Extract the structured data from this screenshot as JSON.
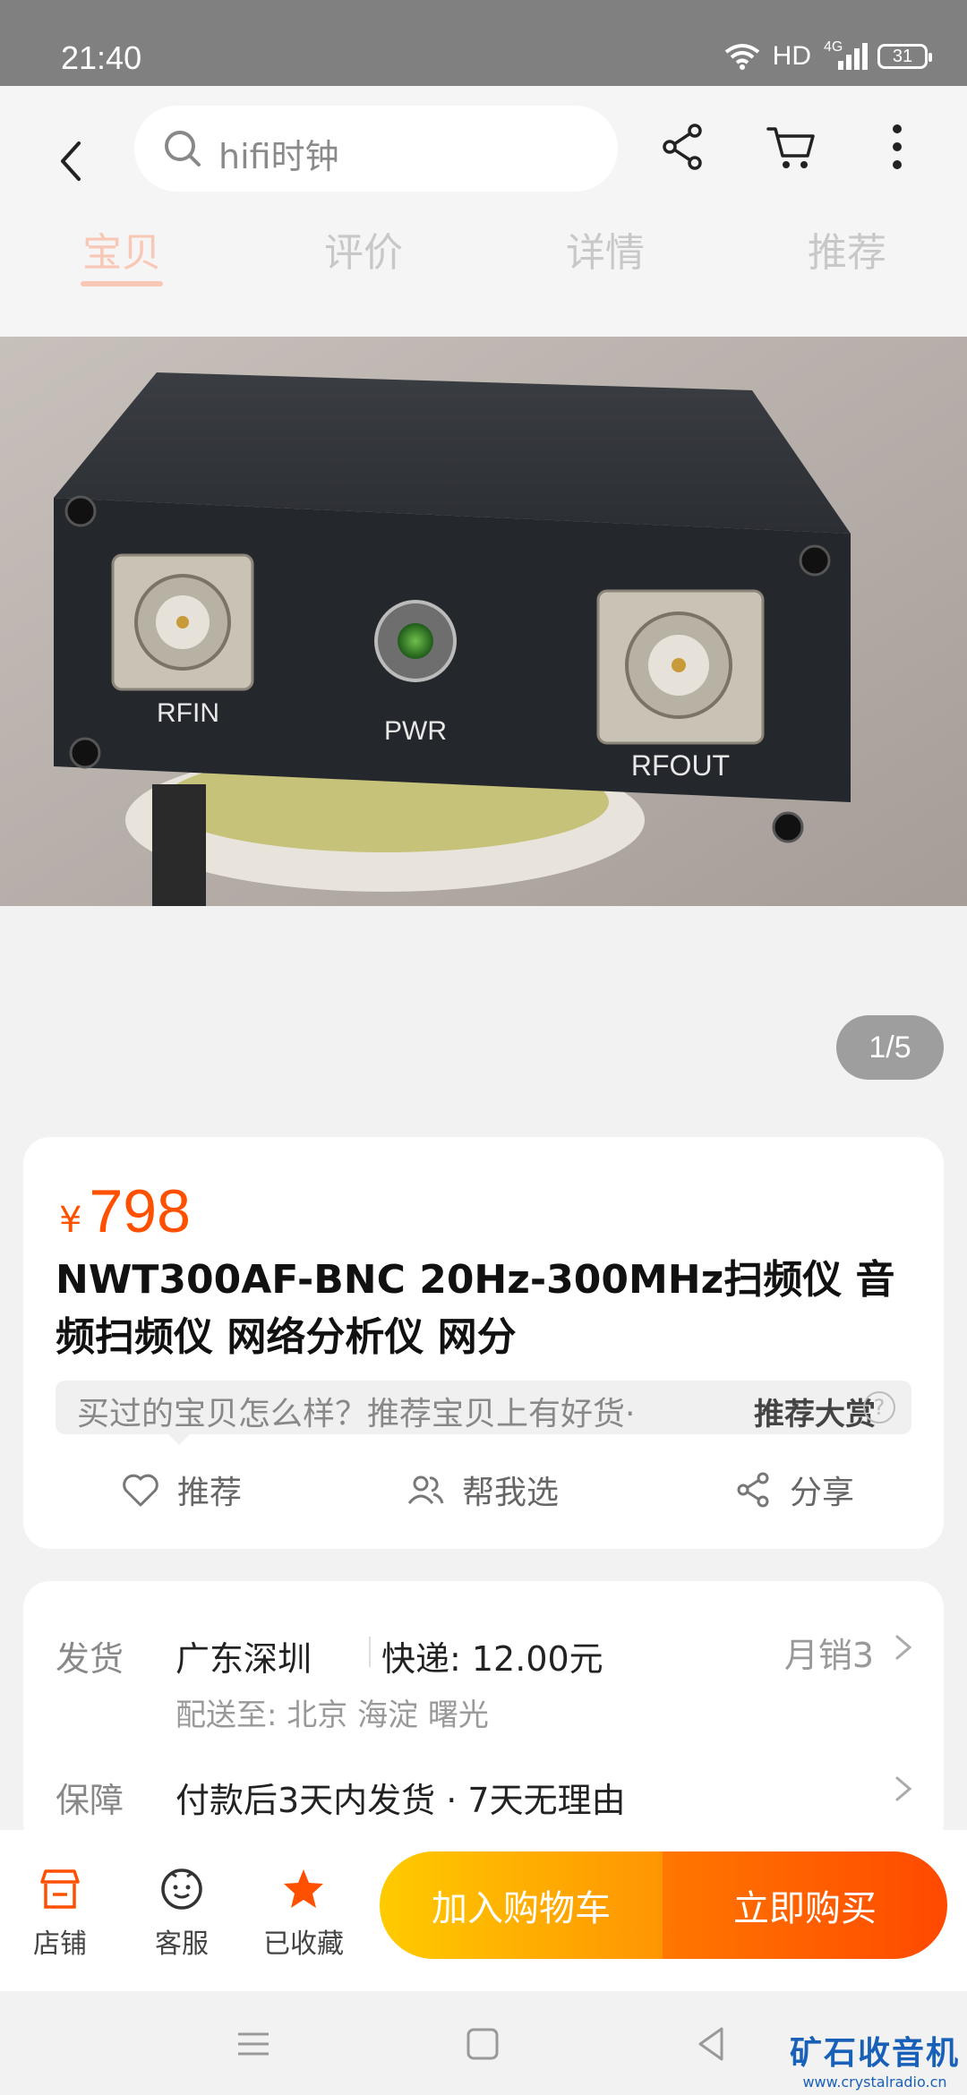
{
  "status_bar": {
    "time": "21:40",
    "hd": "HD",
    "network": "4G",
    "battery": "31"
  },
  "header": {
    "search_text": "hifi时钟",
    "tabs": [
      "宝贝",
      "评价",
      "详情",
      "推荐"
    ],
    "active_tab": "宝贝"
  },
  "gallery": {
    "pager": "1/5",
    "labels": {
      "rf_in": "RFIN",
      "pwr": "PWR",
      "rf_out": "RFOUT"
    }
  },
  "product": {
    "currency": "¥",
    "price": "798",
    "title": "NWT300AF-BNC 20Hz-300MHz扫频仪 音频扫频仪 网络分析仪 网分",
    "promo_text": "买过的宝贝怎么样？推荐宝贝上有好货·",
    "promo_strong": "推荐大赏",
    "promo_help": "?",
    "actions": {
      "recommend": "推荐",
      "help_choose": "帮我选",
      "share": "分享"
    }
  },
  "shipping": {
    "ship_label": "发货",
    "origin": "广东深圳",
    "express": "快递: 12.00元",
    "monthly_sales": "月销3",
    "delivery_to": "配送至: 北京 海淀 曙光",
    "guarantee_label": "保障",
    "guarantee": "付款后3天内发货 · 7天无理由"
  },
  "bottom_bar": {
    "store": "店铺",
    "service": "客服",
    "favorited": "已收藏",
    "add_cart": "加入购物车",
    "buy_now": "立即购买"
  },
  "watermark": {
    "cn": "矿石收音机",
    "url": "www.crystalradio.cn"
  },
  "colors": {
    "accent": "#ff5000",
    "cart_btn": "#ffa500",
    "buy_btn": "#ff5500",
    "favorite_star": "#ff5000"
  }
}
